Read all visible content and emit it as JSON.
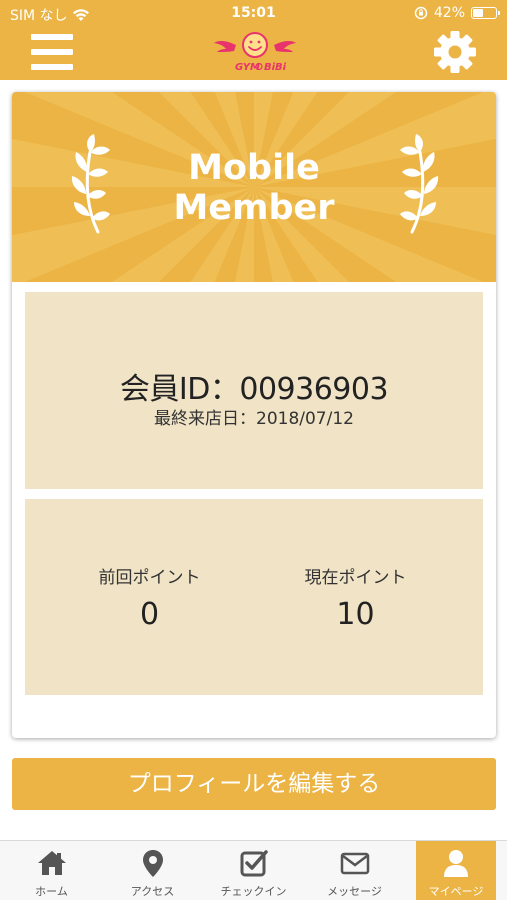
{
  "status_bar": {
    "carrier": "SIM なし",
    "time": "15:01",
    "battery": "42%",
    "battery_level": 0.42
  },
  "header": {
    "logo_text_left": "GYM",
    "logo_text_right": "BiBi",
    "menu_icon": "hamburger-icon",
    "settings_icon": "gear-icon"
  },
  "card": {
    "title": "Mobile\nMember",
    "member_id_label": "会員ID：",
    "member_id": "00936903",
    "last_visit_label": "最終来店日：",
    "last_visit": "2018/07/12",
    "points": {
      "previous_label": "前回ポイント",
      "previous_value": "0",
      "current_label": "現在ポイント",
      "current_value": "10"
    }
  },
  "edit_button": "プロフィールを編集する",
  "tabs": [
    {
      "label": "ホーム",
      "icon": "home-icon"
    },
    {
      "label": "アクセス",
      "icon": "map-pin-icon"
    },
    {
      "label": "チェックイン",
      "icon": "checkbox-icon"
    },
    {
      "label": "メッセージ",
      "icon": "mail-icon"
    },
    {
      "label": "マイページ",
      "icon": "user-icon"
    }
  ],
  "colors": {
    "accent": "#ebb444",
    "panel": "#f0e3c6",
    "logo": "#e8336d"
  }
}
